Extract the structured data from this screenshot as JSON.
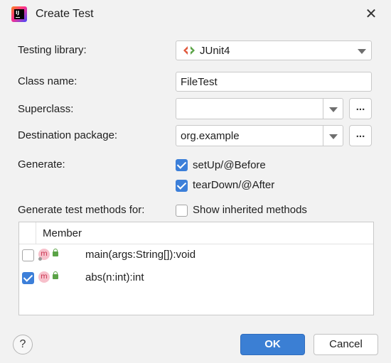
{
  "window": {
    "title": "Create Test"
  },
  "form": {
    "testing_library_label": "Testing library:",
    "testing_library_value": "JUnit4",
    "class_name_label": "Class name:",
    "class_name_value": "FileTest",
    "superclass_label": "Superclass:",
    "superclass_value": "",
    "destination_label": "Destination package:",
    "destination_value": "org.example",
    "browse_label": "...",
    "generate_label": "Generate:",
    "generate_options": [
      {
        "label": "setUp/@Before",
        "checked": true
      },
      {
        "label": "tearDown/@After",
        "checked": true
      }
    ],
    "methods_for_label": "Generate test methods for:",
    "show_inherited": {
      "label": "Show inherited methods",
      "checked": false
    }
  },
  "table": {
    "header": "Member",
    "rows": [
      {
        "icon": "m",
        "signature": "main(args:String[]):void",
        "checked": false
      },
      {
        "icon": "m",
        "signature": "abs(n:int):int",
        "checked": true
      }
    ]
  },
  "buttons": {
    "help": "?",
    "ok": "OK",
    "cancel": "Cancel"
  },
  "colors": {
    "accent": "#3b7fd4",
    "background": "#f2f2f2"
  }
}
